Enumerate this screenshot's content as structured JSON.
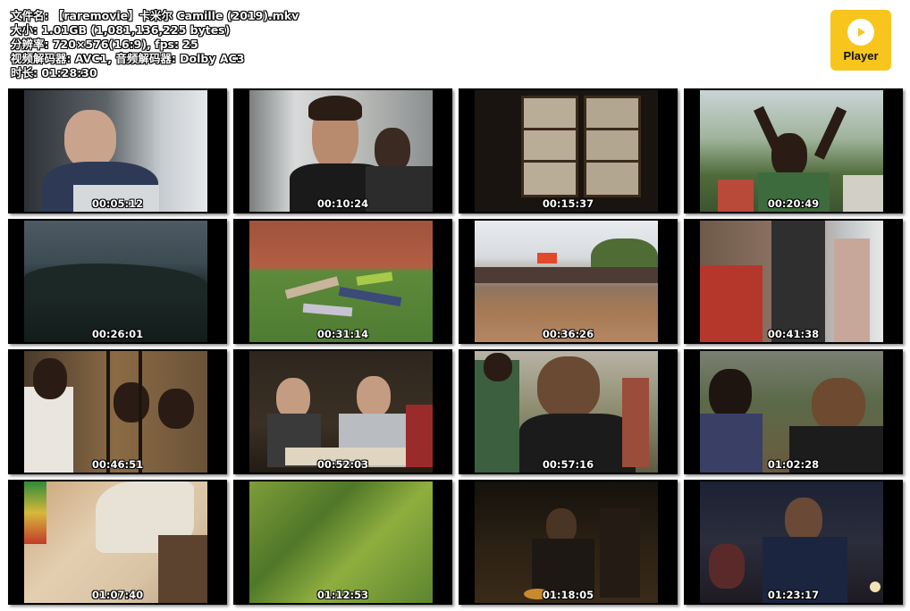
{
  "info": {
    "filename": "文件名: 【raremovie】卡米尔 Camille (2019).mkv",
    "size": "大小: 1.01GB (1,081,136,225 bytes)",
    "resolution": "分辨率: 720×576(16:9), fps: 25",
    "codec": "视频解码器: AVC1, 音频解码器: Dolby AC3",
    "duration": "时长: 01:28:30"
  },
  "player": {
    "label": "Player",
    "accent": "#f7c51c"
  },
  "thumbnails": [
    {
      "time": "00:05:12"
    },
    {
      "time": "00:10:24"
    },
    {
      "time": "00:15:37"
    },
    {
      "time": "00:20:49"
    },
    {
      "time": "00:26:01"
    },
    {
      "time": "00:31:14"
    },
    {
      "time": "00:36:26"
    },
    {
      "time": "00:41:38"
    },
    {
      "time": "00:46:51"
    },
    {
      "time": "00:52:03"
    },
    {
      "time": "00:57:16"
    },
    {
      "time": "01:02:28"
    },
    {
      "time": "01:07:40"
    },
    {
      "time": "01:12:53"
    },
    {
      "time": "01:18:05"
    },
    {
      "time": "01:23:17"
    }
  ]
}
